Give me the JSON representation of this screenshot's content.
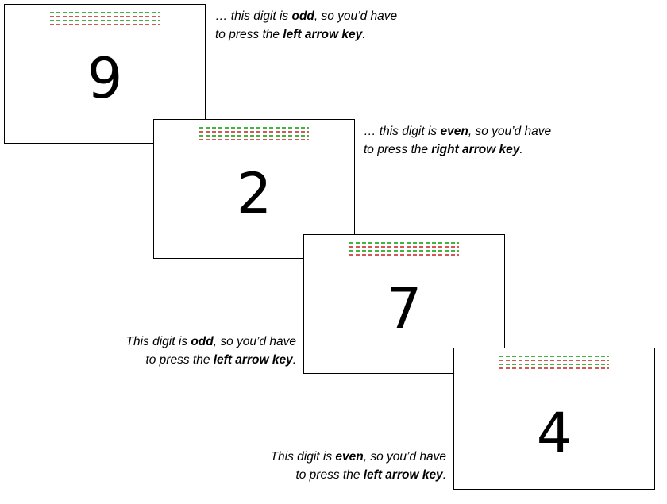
{
  "colors": {
    "green": "#3db83d",
    "red": "#d9535a",
    "text": "#000000",
    "card_border": "#000000"
  },
  "cards": [
    {
      "digit": "9",
      "caption": {
        "prefix": "… this digit is ",
        "parity": "odd",
        "middle": ", so you’d have",
        "line2_prefix": "to press the ",
        "key": "left arrow key",
        "suffix": "."
      }
    },
    {
      "digit": "2",
      "caption": {
        "prefix": "… this digit is ",
        "parity": "even",
        "middle": ", so you’d have",
        "line2_prefix": "to press the ",
        "key": "right arrow key",
        "suffix": "."
      }
    },
    {
      "digit": "7",
      "caption": {
        "prefix": "This digit is ",
        "parity": "odd",
        "middle": ", so you’d have",
        "line2_prefix": "to press the ",
        "key": "left arrow key",
        "suffix": "."
      }
    },
    {
      "digit": "4",
      "caption": {
        "prefix": "This digit is ",
        "parity": "even",
        "middle": ", so you’d have",
        "line2_prefix": "to press the ",
        "key": "left arrow key",
        "suffix": "."
      }
    }
  ],
  "dash_pattern": [
    "green",
    "red",
    "green",
    "red"
  ]
}
